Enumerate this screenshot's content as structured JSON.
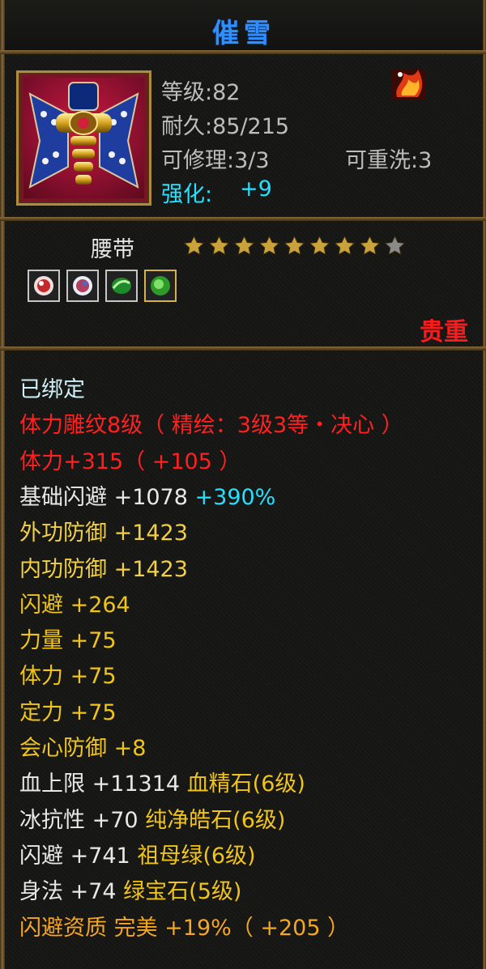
{
  "item": {
    "name": "催雪",
    "level": "等级:82",
    "durability": "耐久:85/215",
    "repairable": "可修理:3/3",
    "rewashable": "可重洗:3",
    "enhance_label": "强化:",
    "enhance_value": "+9",
    "type": "腰带",
    "stars_filled": 8,
    "stars_total": 9,
    "rarity": "贵重"
  },
  "props": [
    {
      "parts": [
        {
          "t": "已绑定",
          "c": "c-cyanish"
        }
      ]
    },
    {
      "parts": [
        {
          "t": "体力雕纹8级（ 精绘：3级3等・决心 ）",
          "c": "c-red"
        }
      ]
    },
    {
      "parts": [
        {
          "t": "体力+315（ +105 ）",
          "c": "c-red"
        }
      ]
    },
    {
      "parts": [
        {
          "t": "基础闪避 +1078 ",
          "c": "c-light"
        },
        {
          "t": "+390%",
          "c": "cyan"
        }
      ]
    },
    {
      "parts": [
        {
          "t": "外功防御 +1423",
          "c": "c-gold"
        }
      ]
    },
    {
      "parts": [
        {
          "t": "内功防御 +1423",
          "c": "c-gold"
        }
      ]
    },
    {
      "parts": [
        {
          "t": "闪避 +264",
          "c": "c-yellow"
        }
      ]
    },
    {
      "parts": [
        {
          "t": "力量 +75",
          "c": "c-yellow"
        }
      ]
    },
    {
      "parts": [
        {
          "t": "体力 +75",
          "c": "c-yellow"
        }
      ]
    },
    {
      "parts": [
        {
          "t": "定力 +75",
          "c": "c-yellow"
        }
      ]
    },
    {
      "parts": [
        {
          "t": "会心防御 +8",
          "c": "c-yellow"
        }
      ]
    },
    {
      "parts": [
        {
          "t": "血上限 +11314 ",
          "c": "c-light"
        },
        {
          "t": "血精石(6级)",
          "c": "c-yellow"
        }
      ]
    },
    {
      "parts": [
        {
          "t": "冰抗性 +70 ",
          "c": "c-light"
        },
        {
          "t": "纯净皓石(6级)",
          "c": "c-yellow"
        }
      ]
    },
    {
      "parts": [
        {
          "t": "闪避 +741 ",
          "c": "c-light"
        },
        {
          "t": "祖母绿(6级)",
          "c": "c-yellow"
        }
      ]
    },
    {
      "parts": [
        {
          "t": "身法 +74 ",
          "c": "c-light"
        },
        {
          "t": "绿宝石(5级)",
          "c": "c-yellow"
        }
      ]
    },
    {
      "parts": [
        {
          "t": "闪避资质  完美 +19%（ +205 ）",
          "c": "c-orange"
        }
      ]
    }
  ],
  "colors": {
    "title": "#2f8fff",
    "frame": "#8b6b38",
    "rarity": "#ff1a1a",
    "star_gold": "#c9a23c",
    "star_empty": "#8a8a8a"
  },
  "icons": [
    "item-belt-icon",
    "fire-element-icon",
    "gem-red-icon",
    "gem-white-icon",
    "gem-green-icon",
    "gem-emerald-icon"
  ]
}
